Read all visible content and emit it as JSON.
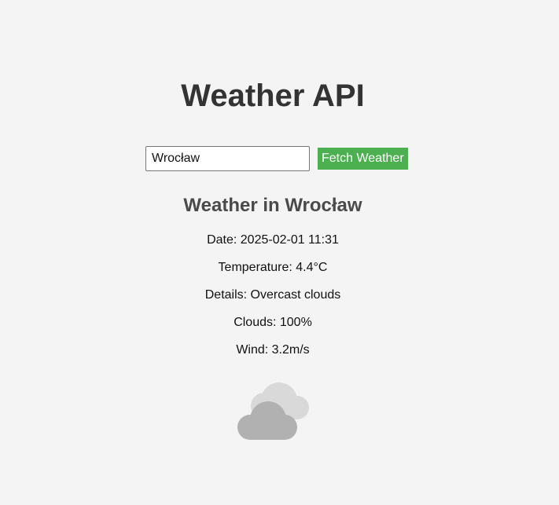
{
  "header": {
    "title": "Weather API"
  },
  "search": {
    "value": "Wrocław",
    "button_label": "Fetch Weather",
    "button_color": "#4caf50"
  },
  "result": {
    "heading": "Weather in Wrocław",
    "date": "Date: 2025-02-01 11:31",
    "temperature": "Temperature: 4.4°C",
    "details": "Details: Overcast clouds",
    "clouds": "Clouds: 100%",
    "wind": "Wind: 3.2m/s",
    "icon": "overcast-clouds-icon"
  }
}
